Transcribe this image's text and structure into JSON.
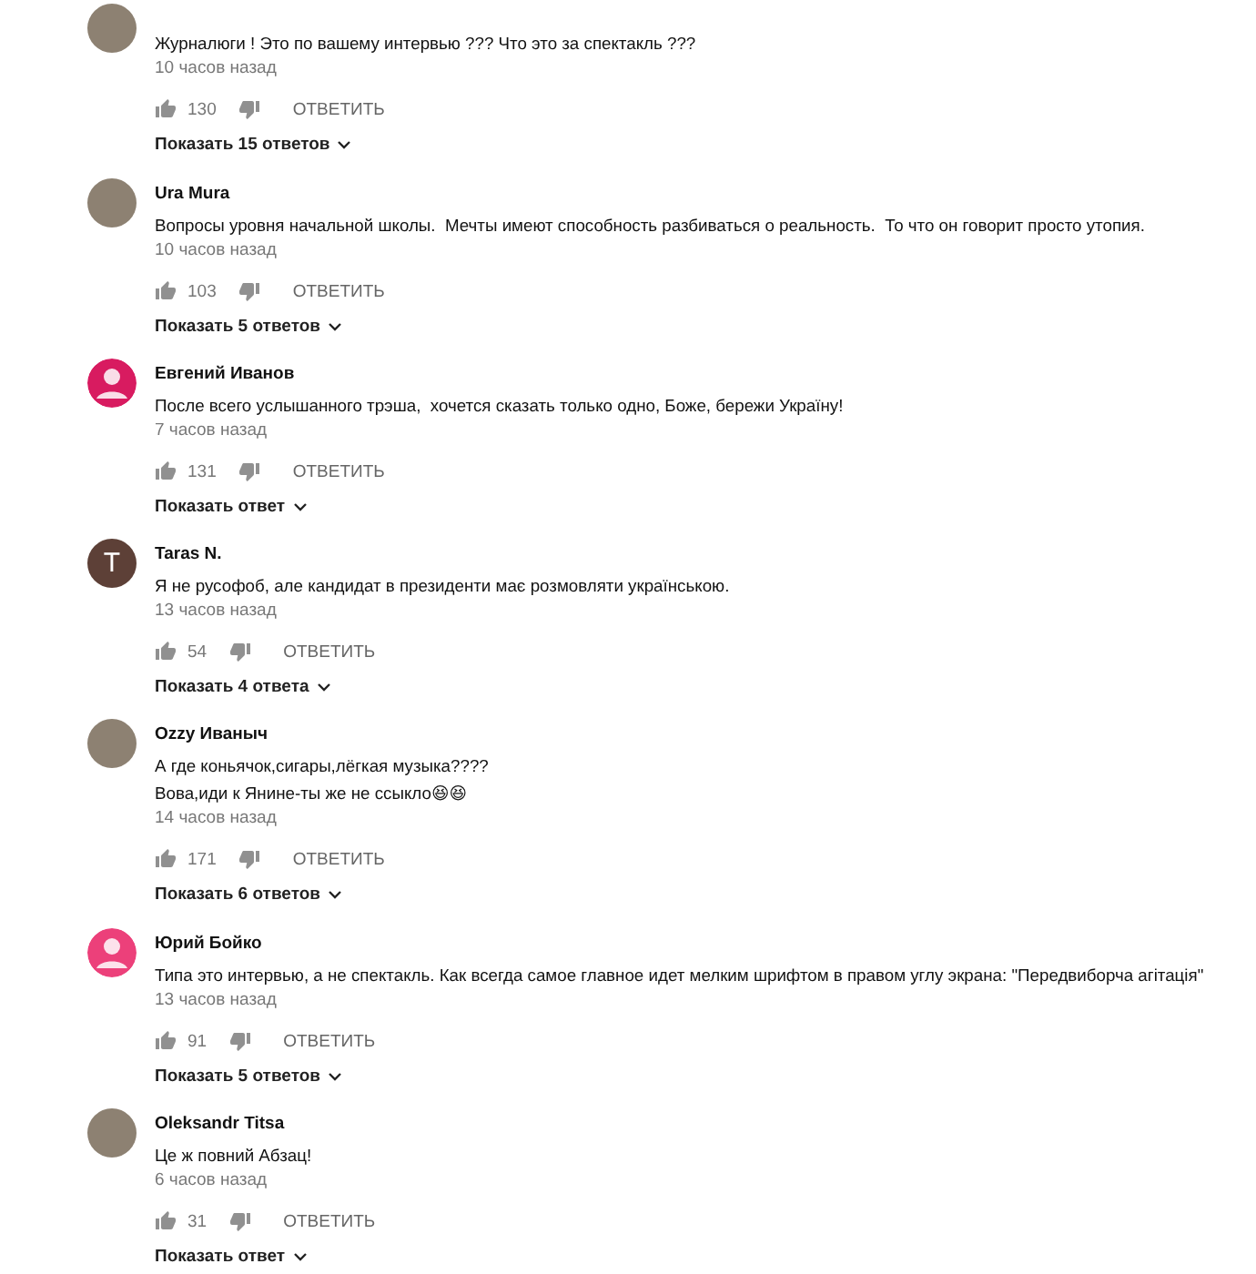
{
  "comments": [
    {
      "avatar": {
        "kind": "photo"
      },
      "text": "Журналюги ! Это по вашему интервью ??? Что это за спектакль ???",
      "time": "10 часов назад",
      "likes": "130",
      "reply": "ОТВЕТИТЬ",
      "replies": "Показать 15 ответов"
    },
    {
      "avatar": {
        "kind": "photo"
      },
      "author": "Ura Mura",
      "text": "Вопросы уровня начальной школы.  Мечты имеют способность разбиваться о реальность.  То что он говорит просто утопия.",
      "time": "10 часов назад",
      "likes": "103",
      "reply": "ОТВЕТИТЬ",
      "replies": "Показать 5 ответов"
    },
    {
      "avatar": {
        "kind": "silhouette",
        "color": "#d81b60"
      },
      "author": "Евгений Иванов",
      "text": "После всего услышанного трэша,  хочется сказать только одно, Боже, бережи Україну!",
      "time": "7 часов назад",
      "likes": "131",
      "reply": "ОТВЕТИТЬ",
      "replies": "Показать ответ"
    },
    {
      "avatar": {
        "kind": "letter",
        "letter": "T",
        "color": "#5d4037"
      },
      "author": "Taras N.",
      "text": "Я не русофоб, але кандидат в президенти має розмовляти українською.",
      "time": "13 часов назад",
      "likes": "54",
      "reply": "ОТВЕТИТЬ",
      "replies": "Показать 4 ответа"
    },
    {
      "avatar": {
        "kind": "photo"
      },
      "author": "Ozzy Иваныч",
      "text": "А где коньячок,сигары,лёгкая музыка????\nВова,иди к Янине-ты же не ссыкло😆😆",
      "time": "14 часов назад",
      "likes": "171",
      "reply": "ОТВЕТИТЬ",
      "replies": "Показать 6 ответов"
    },
    {
      "avatar": {
        "kind": "silhouette",
        "color": "#ec407a"
      },
      "author": "Юрий Бойко",
      "text": "Типа это интервью, а не спектакль. Как всегда самое главное идет мелким шрифтом в правом углу экрана: \"Передвиборча агітація\"",
      "time": "13 часов назад",
      "likes": "91",
      "reply": "ОТВЕТИТЬ",
      "replies": "Показать 5 ответов"
    },
    {
      "avatar": {
        "kind": "photo"
      },
      "author": "Oleksandr Titsa",
      "text": "Це ж повний Абзац!",
      "time": "6 часов назад",
      "likes": "31",
      "reply": "ОТВЕТИТЬ",
      "replies": "Показать ответ"
    }
  ]
}
